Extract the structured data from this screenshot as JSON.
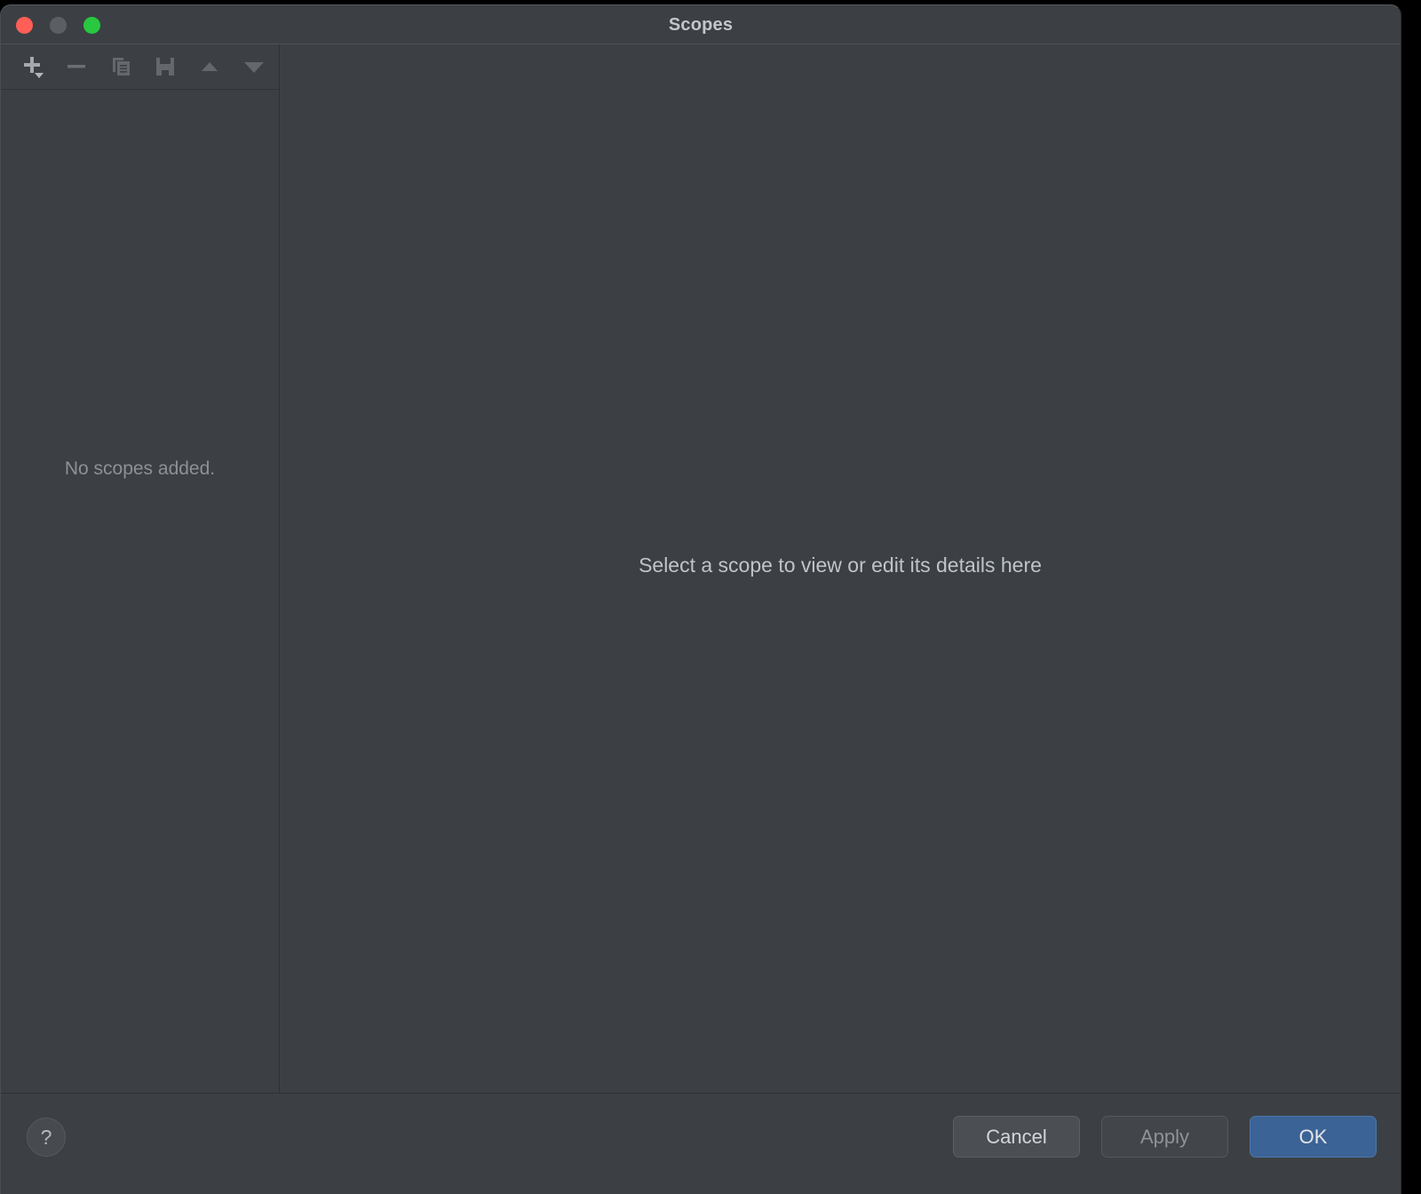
{
  "window": {
    "title": "Scopes",
    "traffic_lights": [
      {
        "name": "close",
        "color": "#ff5f57"
      },
      {
        "name": "minimize",
        "color": "#5b5f63"
      },
      {
        "name": "zoom",
        "color": "#28c840"
      }
    ]
  },
  "toolbar": {
    "buttons": [
      {
        "icon": "add-icon",
        "tooltip": "Add"
      },
      {
        "icon": "remove-icon",
        "tooltip": "Remove"
      },
      {
        "icon": "copy-icon",
        "tooltip": "Duplicate"
      },
      {
        "icon": "save-icon",
        "tooltip": "Save"
      },
      {
        "icon": "arrow-up-icon",
        "tooltip": "Move Up"
      },
      {
        "icon": "arrow-down-icon",
        "tooltip": "Move Down"
      }
    ]
  },
  "sidebar": {
    "empty_message": "No scopes added."
  },
  "details": {
    "empty_message": "Select a scope to view or edit its details here"
  },
  "footer": {
    "help_label": "?",
    "cancel_label": "Cancel",
    "apply_label": "Apply",
    "ok_label": "OK",
    "accent_color": "#3c6395"
  }
}
